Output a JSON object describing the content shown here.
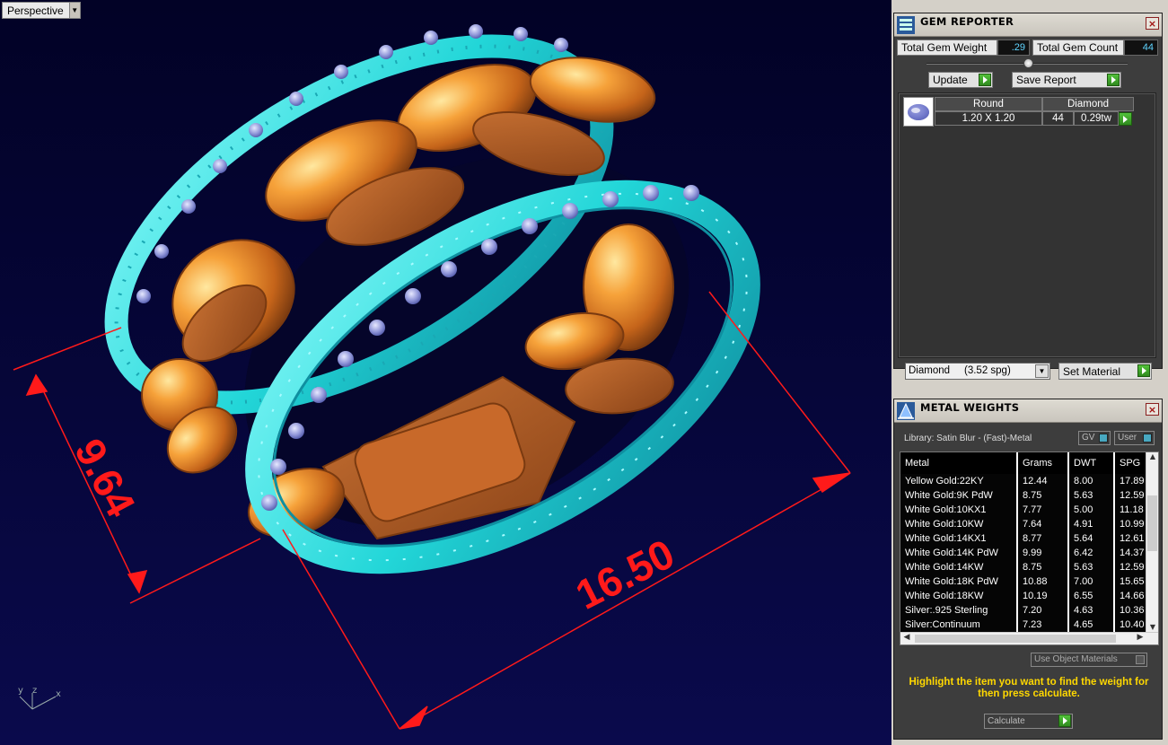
{
  "viewport": {
    "label": "Perspective",
    "dim_width": "9.64",
    "dim_length": "16.50",
    "axis_y": "y",
    "axis_z": "z",
    "axis_x": "x"
  },
  "gem_reporter": {
    "title": "GEM REPORTER",
    "close": "×",
    "total_weight_label": "Total Gem Weight",
    "total_weight_value": ".29",
    "total_count_label": "Total Gem Count",
    "total_count_value": "44",
    "update_label": "Update",
    "save_report_label": "Save Report",
    "gems": [
      {
        "shape": "Round",
        "material": "Diamond",
        "size": "1.20 X 1.20",
        "count": "44",
        "weight": "0.29tw"
      }
    ],
    "material_select": "Diamond     (3.52 spg)",
    "set_material_label": "Set Material"
  },
  "metal_weights": {
    "title": "METAL WEIGHTS",
    "close": "×",
    "library": "Library: Satin Blur - (Fast)-Metal",
    "gv_label": "GV",
    "user_label": "User",
    "columns": [
      "Metal",
      "Grams",
      "DWT",
      "SPG"
    ],
    "rows": [
      [
        "Yellow Gold:22KY",
        "12.44",
        "8.00",
        "17.89"
      ],
      [
        "White Gold:9K PdW",
        "8.75",
        "5.63",
        "12.59"
      ],
      [
        "White Gold:10KX1",
        "7.77",
        "5.00",
        "11.18"
      ],
      [
        "White Gold:10KW",
        "7.64",
        "4.91",
        "10.99"
      ],
      [
        "White Gold:14KX1",
        "8.77",
        "5.64",
        "12.61"
      ],
      [
        "White Gold:14K PdW",
        "9.99",
        "6.42",
        "14.37"
      ],
      [
        "White Gold:14KW",
        "8.75",
        "5.63",
        "12.59"
      ],
      [
        "White Gold:18K PdW",
        "10.88",
        "7.00",
        "15.65"
      ],
      [
        "White Gold:18KW",
        "10.19",
        "6.55",
        "14.66"
      ],
      [
        "Silver:.925 Sterling",
        "7.20",
        "4.63",
        "10.36"
      ],
      [
        "Silver:Continuum",
        "7.23",
        "4.65",
        "10.40"
      ]
    ],
    "use_object_materials": "Use Object Materials",
    "hint": "Highlight the item you want to find the weight for then press calculate.",
    "calculate_label": "Calculate"
  },
  "colors": {
    "band": "#2fd8d8",
    "metal": "#e07a1e",
    "dimension": "#ff1a1a",
    "hint": "#ffd800"
  }
}
